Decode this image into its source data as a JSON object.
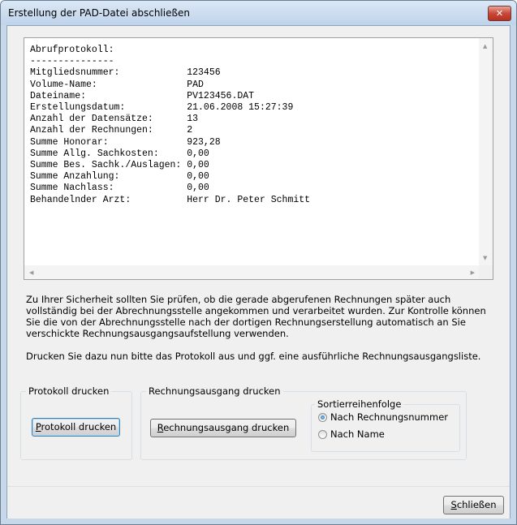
{
  "window": {
    "title": "Erstellung der PAD-Datei abschließen",
    "close_glyph": "✕"
  },
  "protocol": {
    "header": "Abrufprotokoll:",
    "separator": "---------------",
    "rows": [
      {
        "label": "Mitgliedsnummer:",
        "value": "123456"
      },
      {
        "label": "Volume-Name:",
        "value": "PAD"
      },
      {
        "label": "Dateiname:",
        "value": "PV123456.DAT"
      },
      {
        "label": "Erstellungsdatum:",
        "value": "21.06.2008 15:27:39"
      },
      {
        "label": "Anzahl der Datensätze:",
        "value": "13"
      },
      {
        "label": "Anzahl der Rechnungen:",
        "value": "2"
      },
      {
        "label": "Summe Honorar:",
        "value": "923,28"
      },
      {
        "label": "Summe Allg. Sachkosten:",
        "value": "0,00"
      },
      {
        "label": "Summe Bes. Sachk./Auslagen:",
        "value": "0,00"
      },
      {
        "label": "Summe Anzahlung:",
        "value": "0,00"
      },
      {
        "label": "Summe Nachlass:",
        "value": "0,00"
      },
      {
        "label": "Behandelnder Arzt:",
        "value": "Herr Dr. Peter Schmitt"
      }
    ]
  },
  "info": {
    "paragraph1": "Zu Ihrer Sicherheit sollten Sie prüfen, ob die gerade abgerufenen Rechnungen später auch vollständig bei der Abrechnungsstelle angekommen und verarbeitet wurden. Zur Kontrolle können Sie die von der Abrechnungsstelle nach der dortigen Rechnungserstellung automatisch an Sie verschickte Rechnungsausgangsaufstellung verwenden.",
    "paragraph2": "Drucken Sie dazu nun bitte das Protokoll aus und ggf. eine ausführliche Rechnungsausgangsliste."
  },
  "protocol_group": {
    "label": "Protokoll drucken",
    "button_mnemonic": "P",
    "button_rest": "rotokoll drucken"
  },
  "invoice_group": {
    "label": "Rechnungsausgang drucken",
    "button_mnemonic": "R",
    "button_rest": "echnungsausgang drucken",
    "sort": {
      "label": "Sortierreihenfolge",
      "options": [
        {
          "label": "Nach Rechnungsnummer",
          "checked": true
        },
        {
          "label": "Nach Name",
          "checked": false
        }
      ]
    }
  },
  "footer": {
    "close_mnemonic": "S",
    "close_rest": "chließen"
  }
}
